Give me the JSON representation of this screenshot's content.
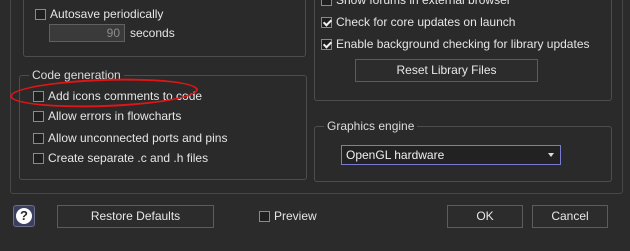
{
  "autosave": {
    "checkbox_label": "Autosave periodically",
    "checked": false,
    "interval_value": "90",
    "interval_unit": "seconds"
  },
  "code_generation": {
    "title": "Code generation",
    "options": [
      {
        "label": "Add icons comments to code",
        "checked": false
      },
      {
        "label": "Allow errors in flowcharts",
        "checked": false
      },
      {
        "label": "Allow unconnected ports and pins",
        "checked": false
      },
      {
        "label": "Create separate .c and .h files",
        "checked": false
      }
    ]
  },
  "updates": {
    "options": [
      {
        "label": "Show forums in external browser",
        "checked": false
      },
      {
        "label": "Check for core updates on launch",
        "checked": true
      },
      {
        "label": "Enable background checking for library updates",
        "checked": true
      }
    ],
    "reset_button": "Reset Library Files"
  },
  "graphics_engine": {
    "title": "Graphics engine",
    "selected": "OpenGL hardware"
  },
  "footer": {
    "help_icon": "?",
    "restore_button": "Restore Defaults",
    "preview_label": "Preview",
    "preview_checked": false,
    "ok_button": "OK",
    "cancel_button": "Cancel"
  },
  "colors": {
    "background": "#2b2b2b",
    "annotation": "#e01515",
    "select_border": "#7a7ad0"
  }
}
